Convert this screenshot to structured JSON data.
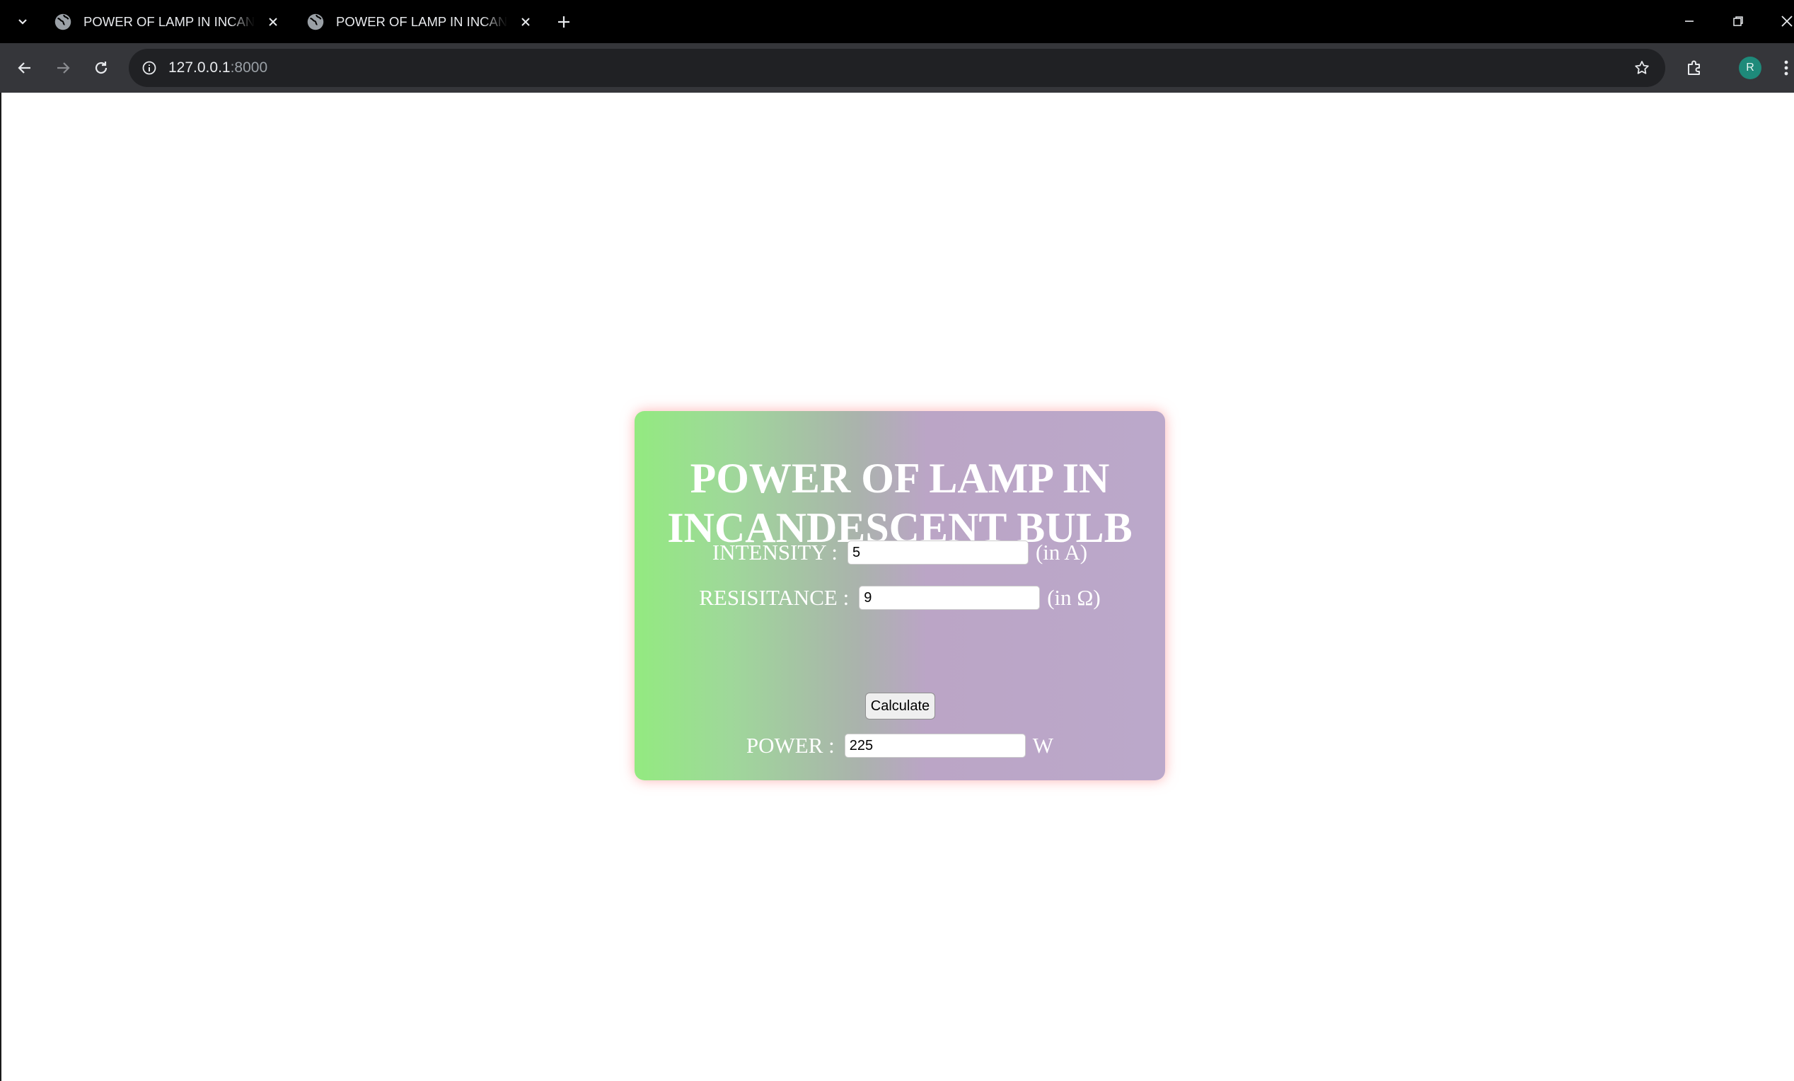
{
  "browser": {
    "tabs": [
      {
        "title": "POWER OF LAMP IN INCANDESCENT BULB"
      },
      {
        "title": "POWER OF LAMP IN INCANDESCENT BULB"
      }
    ],
    "url_host": "127.0.0.1",
    "url_port": ":8000",
    "profile_initial": "R"
  },
  "page": {
    "title": "POWER OF LAMP IN INCANDESCENT BULB",
    "intensity": {
      "label": "INTENSITY :",
      "value": "5",
      "unit": "(in A)"
    },
    "resistance": {
      "label": "RESISITANCE :",
      "value": "9",
      "unit": "(in Ω)"
    },
    "calculate_label": "Calculate",
    "power": {
      "label": "POWER :",
      "value": "225",
      "unit": "W"
    }
  },
  "colors": {
    "card_gradient_start": "#93ea80",
    "card_gradient_end": "#bba8ca",
    "card_glow": "#ff7878"
  }
}
